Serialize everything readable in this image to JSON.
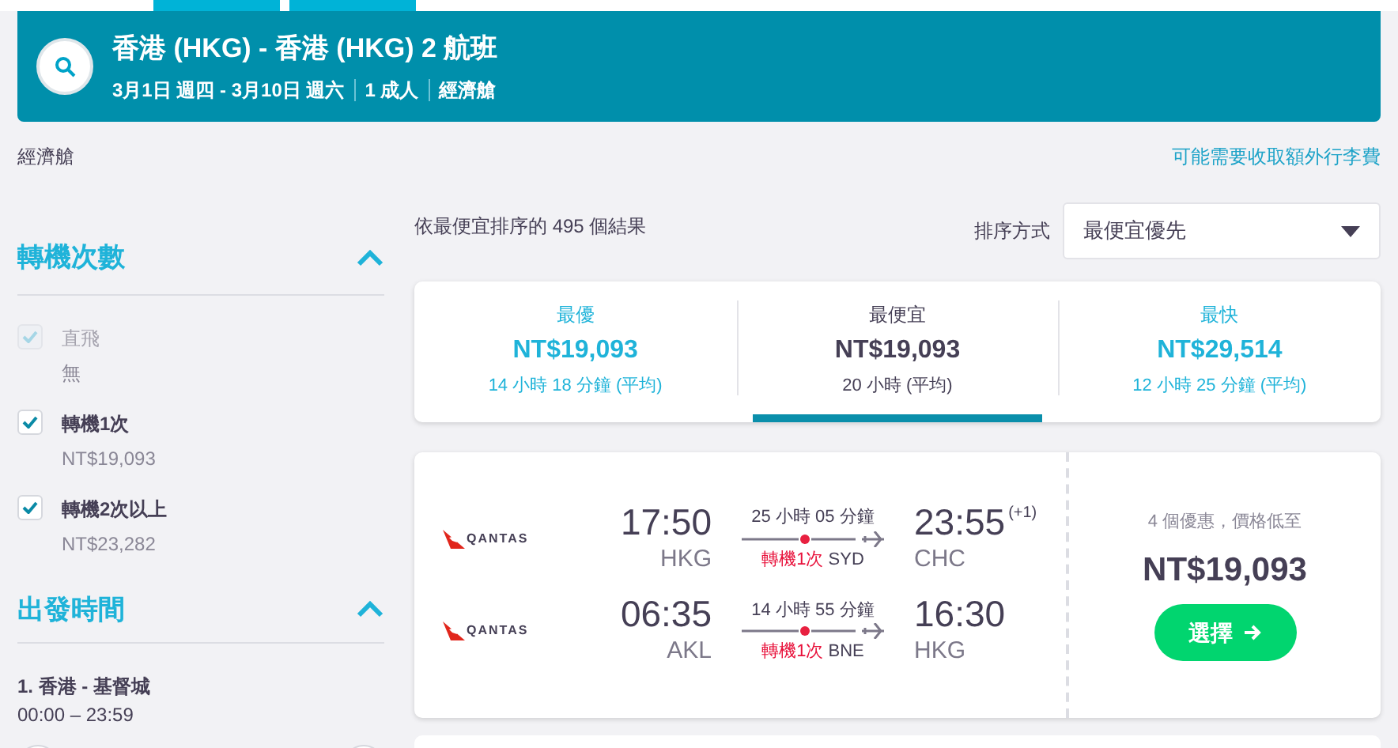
{
  "search_banner": {
    "title": "香港 (HKG) - 香港 (HKG) 2 航班",
    "details": [
      "3月1日 週四 - 3月10日 週六",
      "1 成人",
      "經濟艙"
    ]
  },
  "cabin_label": "經濟艙",
  "baggage_note": "可能需要收取額外行李費",
  "filters": {
    "stops": {
      "title": "轉機次數",
      "expanded": true,
      "options": [
        {
          "label": "直飛",
          "price": "無",
          "checked": true,
          "disabled": true
        },
        {
          "label": "轉機1次",
          "price": "NT$19,093",
          "checked": true,
          "disabled": false
        },
        {
          "label": "轉機2次以上",
          "price": "NT$23,282",
          "checked": true,
          "disabled": false
        }
      ]
    },
    "departure_time": {
      "title": "出發時間",
      "expanded": true,
      "legs": [
        {
          "route": "1. 香港 - 基督城",
          "range": "00:00 – 23:59"
        }
      ]
    }
  },
  "results_count": "依最便宜排序的 495 個結果",
  "sort": {
    "label": "排序方式",
    "value": "最便宜優先"
  },
  "summary_tabs": [
    {
      "title": "最優",
      "price": "NT$19,093",
      "duration": "14 小時 18 分鐘 (平均)",
      "selected": false
    },
    {
      "title": "最便宜",
      "price": "NT$19,093",
      "duration": "20 小時 (平均)",
      "selected": true
    },
    {
      "title": "最快",
      "price": "NT$29,514",
      "duration": "12 小時 25 分鐘 (平均)",
      "selected": false
    }
  ],
  "results": [
    {
      "legs": [
        {
          "airline": "QANTAS",
          "depart_time": "17:50",
          "depart_airport": "HKG",
          "duration": "25 小時 05 分鐘",
          "stops": "轉機1次",
          "via": "SYD",
          "arrive_time": "23:55",
          "day_offset": "(+1)",
          "arrive_airport": "CHC"
        },
        {
          "airline": "QANTAS",
          "depart_time": "06:35",
          "depart_airport": "AKL",
          "duration": "14 小時 55 分鐘",
          "stops": "轉機1次",
          "via": "BNE",
          "arrive_time": "16:30",
          "arrive_airport": "HKG"
        }
      ],
      "deals": "4 個優惠，價格低至",
      "price": "NT$19,093",
      "select_button": "選擇"
    }
  ]
}
